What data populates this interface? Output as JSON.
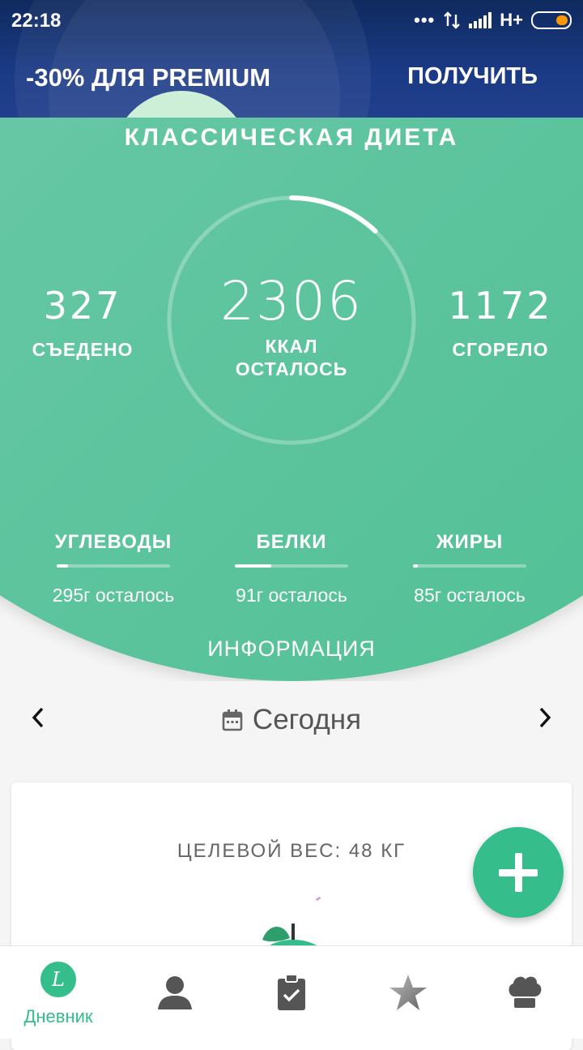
{
  "status_bar": {
    "time": "22:18",
    "network": "H+"
  },
  "promo": {
    "text": "-30% ДЛЯ PREMIUM",
    "action_label": "ПОЛУЧИТЬ"
  },
  "summary": {
    "diet_name": "КЛАССИЧЕСКАЯ ДИЕТА",
    "calories_left": "2306",
    "calories_unit": "ККАЛ",
    "calories_left_label": "ОСТАЛОСЬ",
    "ring_progress_fraction": 0.12,
    "eaten": {
      "value": "327",
      "label": "СЪЕДЕНО"
    },
    "burned": {
      "value": "1172",
      "label": "СГОРЕЛО"
    }
  },
  "macros": [
    {
      "name": "УГЛЕВОДЫ",
      "remaining": "295г осталось",
      "progress_fraction": 0.1
    },
    {
      "name": "БЕЛКИ",
      "remaining": "91г осталось",
      "progress_fraction": 0.32
    },
    {
      "name": "ЖИРЫ",
      "remaining": "85г осталось",
      "progress_fraction": 0.04
    }
  ],
  "info_label": "ИНФОРМАЦИЯ",
  "date_nav": {
    "label": "Сегодня",
    "icon": "calendar-icon"
  },
  "target_weight": "ЦЕЛЕВОЙ ВЕС: 48 КГ",
  "fab_icon": "plus-icon",
  "bottom_nav": [
    {
      "label": "Дневник",
      "icon": "diary-icon",
      "active": true
    },
    {
      "label": "",
      "icon": "profile-icon"
    },
    {
      "label": "",
      "icon": "clipboard-check-icon"
    },
    {
      "label": "",
      "icon": "star-icon"
    },
    {
      "label": "",
      "icon": "chef-hat-icon"
    }
  ],
  "colors": {
    "accent": "#35bd8c",
    "header": "#1b3a85",
    "stats_bg": "#5ec5a0"
  }
}
